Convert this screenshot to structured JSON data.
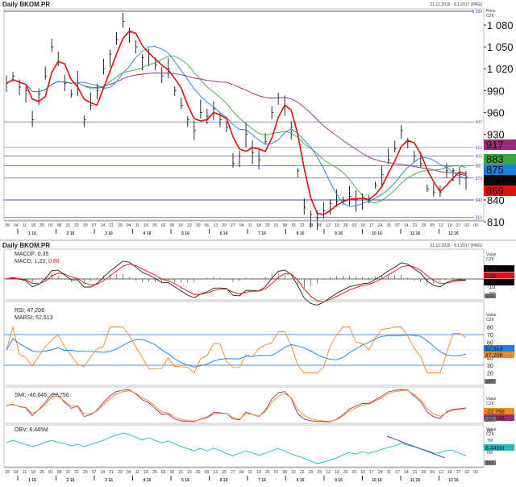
{
  "header": {
    "title": "Daily BKOM.PR",
    "range": "21.12.2015 - 9.1.2017 (PRG)"
  },
  "panes": {
    "price": {
      "unit_line1": "Price",
      "unit_line2": "CZK",
      "axis_ticks": [
        "1 080",
        "1 050",
        "1 020",
        "990",
        "960",
        "930",
        "840",
        "810"
      ],
      "badges": [
        {
          "label": "917",
          "color": "#9b2a7a"
        },
        {
          "label": "883",
          "color": "#3aa83a"
        },
        {
          "label": "875",
          "color": "#1e7fe0"
        },
        {
          "label": "871",
          "color": "#000000"
        },
        {
          "label": "869",
          "color": "#e01010"
        }
      ]
    },
    "macd": {
      "legend1": "MACDF; 0,35",
      "legend2_a": "MACD; 1,23; ",
      "legend2_b": "0,88",
      "unit_line1": "Value",
      "unit_line2": "CZK",
      "axis_ticks": [
        "-10",
        "-20"
      ],
      "badges": [
        {
          "label": "1,23",
          "color": "#000000"
        },
        {
          "label": "0,88",
          "color": "#e01010"
        },
        {
          "label": "0,35",
          "color": "#000000"
        }
      ],
      "off_label": "OFF"
    },
    "rsi": {
      "legend1": "RSI; 47,208",
      "legend2": "MARSI; 52,513",
      "unit_line1": "Value",
      "unit_line2": "CZK",
      "axis_ticks": [
        "80",
        "70",
        "60",
        "40",
        "30",
        "20",
        "10"
      ],
      "badges": [
        {
          "label": "52,513",
          "color": "#1e7fe0"
        },
        {
          "label": "47,208",
          "color": "#f08a20"
        }
      ],
      "off_label": "OFF"
    },
    "smi": {
      "legend": "SMI; -40,646; -22,756",
      "unit_line1": "Value",
      "unit_line2": "CZK",
      "badges": [
        {
          "label": "-22,756",
          "color": "#f08a20"
        },
        {
          "label": "-40,646",
          "color": "#9b2a7a"
        }
      ],
      "off_label": "OFF"
    },
    "obv": {
      "legend": "OBV; 6,445M",
      "unit_line1": "Value",
      "unit_line2": "CZK",
      "axis_ticks": [
        "8M",
        "7M",
        "6M",
        "5M"
      ],
      "badges": [
        {
          "label": "6,445M",
          "color": "#20b8c0"
        }
      ],
      "off_label": "OFF"
    }
  },
  "chart_data": {
    "type": "line",
    "title": "Daily BKOM.PR",
    "xlabel": "",
    "ylabel": "Price CZK",
    "ylim": [
      810,
      1099
    ],
    "horizontal_levels": [
      1099,
      947,
      912,
      900,
      887,
      870,
      840,
      816
    ],
    "horizontal_level_labels": [
      "1 099",
      "947",
      "912",
      "900",
      "887",
      "870",
      "840",
      "816"
    ],
    "date_ticks": [
      "28",
      "04",
      "11",
      "18",
      "25",
      "01",
      "08",
      "15",
      "22",
      "29",
      "07",
      "14",
      "21",
      "29",
      "04",
      "11",
      "18",
      "25",
      "02",
      "09",
      "16",
      "23",
      "30",
      "06",
      "13",
      "20",
      "27",
      "04",
      "11",
      "18",
      "25",
      "01",
      "08",
      "15",
      "22",
      "29",
      "05",
      "12",
      "19",
      "26",
      "03",
      "10",
      "17",
      "24",
      "31",
      "07",
      "14",
      "21",
      "28",
      "05",
      "12",
      "19",
      "27",
      "02",
      "09"
    ],
    "month_labels": [
      "1 16",
      "2 16",
      "3 16",
      "4 16",
      "5 16",
      "6 16",
      "7 16",
      "8 16",
      "9 16",
      "10 16",
      "11 16",
      "12 16"
    ],
    "close": [
      1000,
      1010,
      995,
      990,
      950,
      985,
      1010,
      1050,
      1030,
      1000,
      985,
      1000,
      950,
      970,
      990,
      1020,
      1040,
      1060,
      1085,
      1070,
      1050,
      1035,
      1040,
      1025,
      1010,
      1020,
      990,
      970,
      950,
      935,
      960,
      955,
      965,
      950,
      940,
      890,
      900,
      930,
      905,
      895,
      920,
      960,
      980,
      970,
      940,
      880,
      830,
      820,
      815,
      825,
      835,
      838,
      840,
      845,
      840,
      842,
      840,
      860,
      875,
      895,
      910,
      935,
      920,
      900,
      890,
      855,
      850,
      850,
      880,
      880,
      875,
      871
    ],
    "series": [
      {
        "name": "MA short",
        "color": "#e01010",
        "last": 869
      },
      {
        "name": "MA medium",
        "color": "#3aa83a",
        "last": 883
      },
      {
        "name": "MA medium-long",
        "color": "#1e7fe0",
        "last": 875
      },
      {
        "name": "MA long",
        "color": "#9b2a7a",
        "last": 917
      }
    ],
    "indicators": {
      "MACDF": 0.35,
      "MACD": 1.23,
      "MACD_signal": 0.88,
      "RSI": 47.208,
      "MARSI": 52.513,
      "SMI": -40.646,
      "SMI_signal": -22.756,
      "OBV": "6,445M",
      "rsi_levels": [
        70,
        30
      ]
    }
  }
}
